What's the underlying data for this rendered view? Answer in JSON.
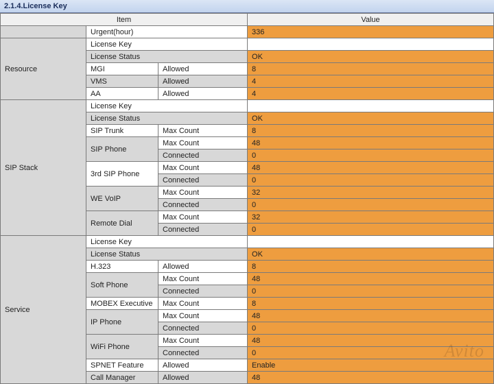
{
  "title": "2.1.4.License Key",
  "headers": {
    "item": "Item",
    "value": "Value"
  },
  "watermark": "Avito",
  "rows": [
    {
      "sectCell": true,
      "sectText": "",
      "i1": "Urgent(hour)",
      "i1cls": "sub-white",
      "span12": true,
      "val": "336",
      "vcls": "val"
    },
    {
      "sectCell": true,
      "sectText": "Resource",
      "sectRows": 5,
      "i1": "License Key",
      "i1cls": "sub-white",
      "span12": true,
      "val": "",
      "vcls": "val-plain"
    },
    {
      "sectCell": false,
      "i1": "License Status",
      "i1cls": "sub-alt",
      "span12": true,
      "val": "OK",
      "vcls": "val"
    },
    {
      "sectCell": false,
      "i1": "MGI",
      "i1cls": "sub-white",
      "i2": "Allowed",
      "i2cls": "sub-white",
      "val": "8",
      "vcls": "val"
    },
    {
      "sectCell": false,
      "i1": "VMS",
      "i1cls": "sub-alt",
      "i2": "Allowed",
      "i2cls": "sub-alt",
      "val": "4",
      "vcls": "val"
    },
    {
      "sectCell": false,
      "i1": "AA",
      "i1cls": "sub-white",
      "i2": "Allowed",
      "i2cls": "sub-white",
      "val": "4",
      "vcls": "val"
    },
    {
      "sectCell": true,
      "sectText": "SIP Stack",
      "sectRows": 11,
      "i1": "License Key",
      "i1cls": "sub-white",
      "span12": true,
      "val": "",
      "vcls": "val-plain"
    },
    {
      "sectCell": false,
      "i1": "License Status",
      "i1cls": "sub-alt",
      "span12": true,
      "val": "OK",
      "vcls": "val"
    },
    {
      "sectCell": false,
      "i1": "SIP Trunk",
      "i1cls": "sub-white",
      "i2": "Max Count",
      "i2cls": "sub-white",
      "val": "8",
      "vcls": "val"
    },
    {
      "sectCell": false,
      "i1": "SIP Phone",
      "i1cls": "sub-alt",
      "i1rows": 2,
      "i2": "Max Count",
      "i2cls": "sub-white",
      "val": "48",
      "vcls": "val"
    },
    {
      "sectCell": false,
      "noI1": true,
      "i2": "Connected",
      "i2cls": "sub-alt",
      "val": "0",
      "vcls": "val"
    },
    {
      "sectCell": false,
      "i1": "3rd SIP Phone",
      "i1cls": "sub-white",
      "i1rows": 2,
      "i2": "Max Count",
      "i2cls": "sub-white",
      "val": "48",
      "vcls": "val"
    },
    {
      "sectCell": false,
      "noI1": true,
      "i2": "Connected",
      "i2cls": "sub-alt",
      "val": "0",
      "vcls": "val"
    },
    {
      "sectCell": false,
      "i1": "WE VoIP",
      "i1cls": "sub-alt",
      "i1rows": 2,
      "i2": "Max Count",
      "i2cls": "sub-white",
      "val": "32",
      "vcls": "val"
    },
    {
      "sectCell": false,
      "noI1": true,
      "i2": "Connected",
      "i2cls": "sub-alt",
      "val": "0",
      "vcls": "val"
    },
    {
      "sectCell": false,
      "i1": "Remote Dial",
      "i1cls": "sub-alt",
      "i1rows": 2,
      "i2": "Max Count",
      "i2cls": "sub-white",
      "val": "32",
      "vcls": "val"
    },
    {
      "sectCell": false,
      "noI1": true,
      "i2": "Connected",
      "i2cls": "sub-alt",
      "val": "0",
      "vcls": "val"
    },
    {
      "sectCell": true,
      "sectText": "Service",
      "sectRows": 12,
      "i1": "License Key",
      "i1cls": "sub-white",
      "span12": true,
      "val": "",
      "vcls": "val-plain"
    },
    {
      "sectCell": false,
      "i1": "License Status",
      "i1cls": "sub-alt",
      "span12": true,
      "val": "OK",
      "vcls": "val"
    },
    {
      "sectCell": false,
      "i1": "H.323",
      "i1cls": "sub-white",
      "i2": "Allowed",
      "i2cls": "sub-white",
      "val": "8",
      "vcls": "val"
    },
    {
      "sectCell": false,
      "i1": "Soft Phone",
      "i1cls": "sub-alt",
      "i1rows": 2,
      "i2": "Max Count",
      "i2cls": "sub-white",
      "val": "48",
      "vcls": "val"
    },
    {
      "sectCell": false,
      "noI1": true,
      "i2": "Connected",
      "i2cls": "sub-alt",
      "val": "0",
      "vcls": "val"
    },
    {
      "sectCell": false,
      "i1": "MOBEX Executive",
      "i1cls": "sub-white",
      "i2": "Max Count",
      "i2cls": "sub-white",
      "val": "8",
      "vcls": "val"
    },
    {
      "sectCell": false,
      "i1": "IP Phone",
      "i1cls": "sub-alt",
      "i1rows": 2,
      "i2": "Max Count",
      "i2cls": "sub-white",
      "val": "48",
      "vcls": "val"
    },
    {
      "sectCell": false,
      "noI1": true,
      "i2": "Connected",
      "i2cls": "sub-alt",
      "val": "0",
      "vcls": "val"
    },
    {
      "sectCell": false,
      "i1": "WiFi Phone",
      "i1cls": "sub-alt",
      "i1rows": 2,
      "i2": "Max Count",
      "i2cls": "sub-white",
      "val": "48",
      "vcls": "val"
    },
    {
      "sectCell": false,
      "noI1": true,
      "i2": "Connected",
      "i2cls": "sub-alt",
      "val": "0",
      "vcls": "val"
    },
    {
      "sectCell": false,
      "i1": "SPNET Feature",
      "i1cls": "sub-white",
      "i2": "Allowed",
      "i2cls": "sub-white",
      "val": "Enable",
      "vcls": "val"
    },
    {
      "sectCell": false,
      "i1": "Call Manager",
      "i1cls": "sub-alt",
      "i2": "Allowed",
      "i2cls": "sub-alt",
      "val": "48",
      "vcls": "val"
    }
  ]
}
